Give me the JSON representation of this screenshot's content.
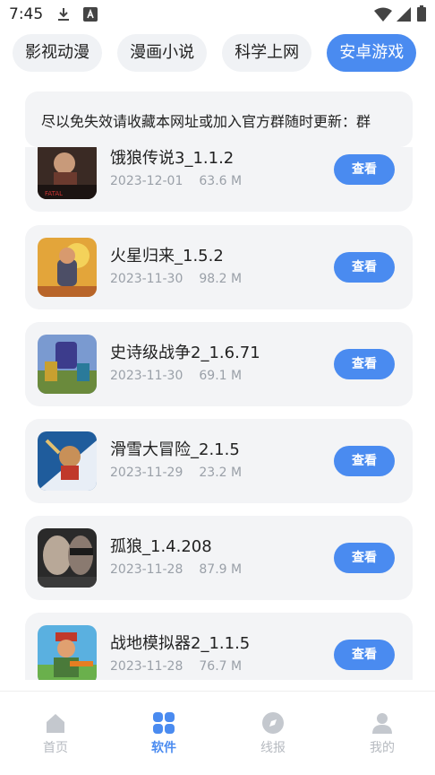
{
  "status_bar": {
    "time": "7:45",
    "icons": [
      "download-icon",
      "app-notification-icon",
      "wifi-icon",
      "signal-icon",
      "battery-icon"
    ]
  },
  "tabs": [
    {
      "label": "影视动漫",
      "active": false
    },
    {
      "label": "漫画小说",
      "active": false
    },
    {
      "label": "科学上网",
      "active": false
    },
    {
      "label": "安卓游戏",
      "active": true
    }
  ],
  "notice": {
    "text": "尽以免失效请收藏本网址或加入官方群随时更新：群"
  },
  "apps": [
    {
      "name": "饿狼传说3_1.1.2",
      "date": "2023-12-01",
      "size": "63.6 M",
      "button": "查看"
    },
    {
      "name": "火星归来_1.5.2",
      "date": "2023-11-30",
      "size": "98.2 M",
      "button": "查看"
    },
    {
      "name": "史诗级战争2_1.6.71",
      "date": "2023-11-30",
      "size": "69.1 M",
      "button": "查看"
    },
    {
      "name": "滑雪大冒险_2.1.5",
      "date": "2023-11-29",
      "size": "23.2 M",
      "button": "查看"
    },
    {
      "name": "孤狼_1.4.208",
      "date": "2023-11-28",
      "size": "87.9 M",
      "button": "查看"
    },
    {
      "name": "战地模拟器2_1.1.5",
      "date": "2023-11-28",
      "size": "76.7 M",
      "button": "查看"
    }
  ],
  "bottom_nav": [
    {
      "label": "首页",
      "icon": "home-icon",
      "active": false
    },
    {
      "label": "软件",
      "icon": "grid-icon",
      "active": true
    },
    {
      "label": "线报",
      "icon": "compass-icon",
      "active": false
    },
    {
      "label": "我的",
      "icon": "user-icon",
      "active": false
    }
  ],
  "colors": {
    "accent": "#4a8bf0",
    "card_bg": "#f3f4f6",
    "muted_text": "#9aa0a8"
  }
}
